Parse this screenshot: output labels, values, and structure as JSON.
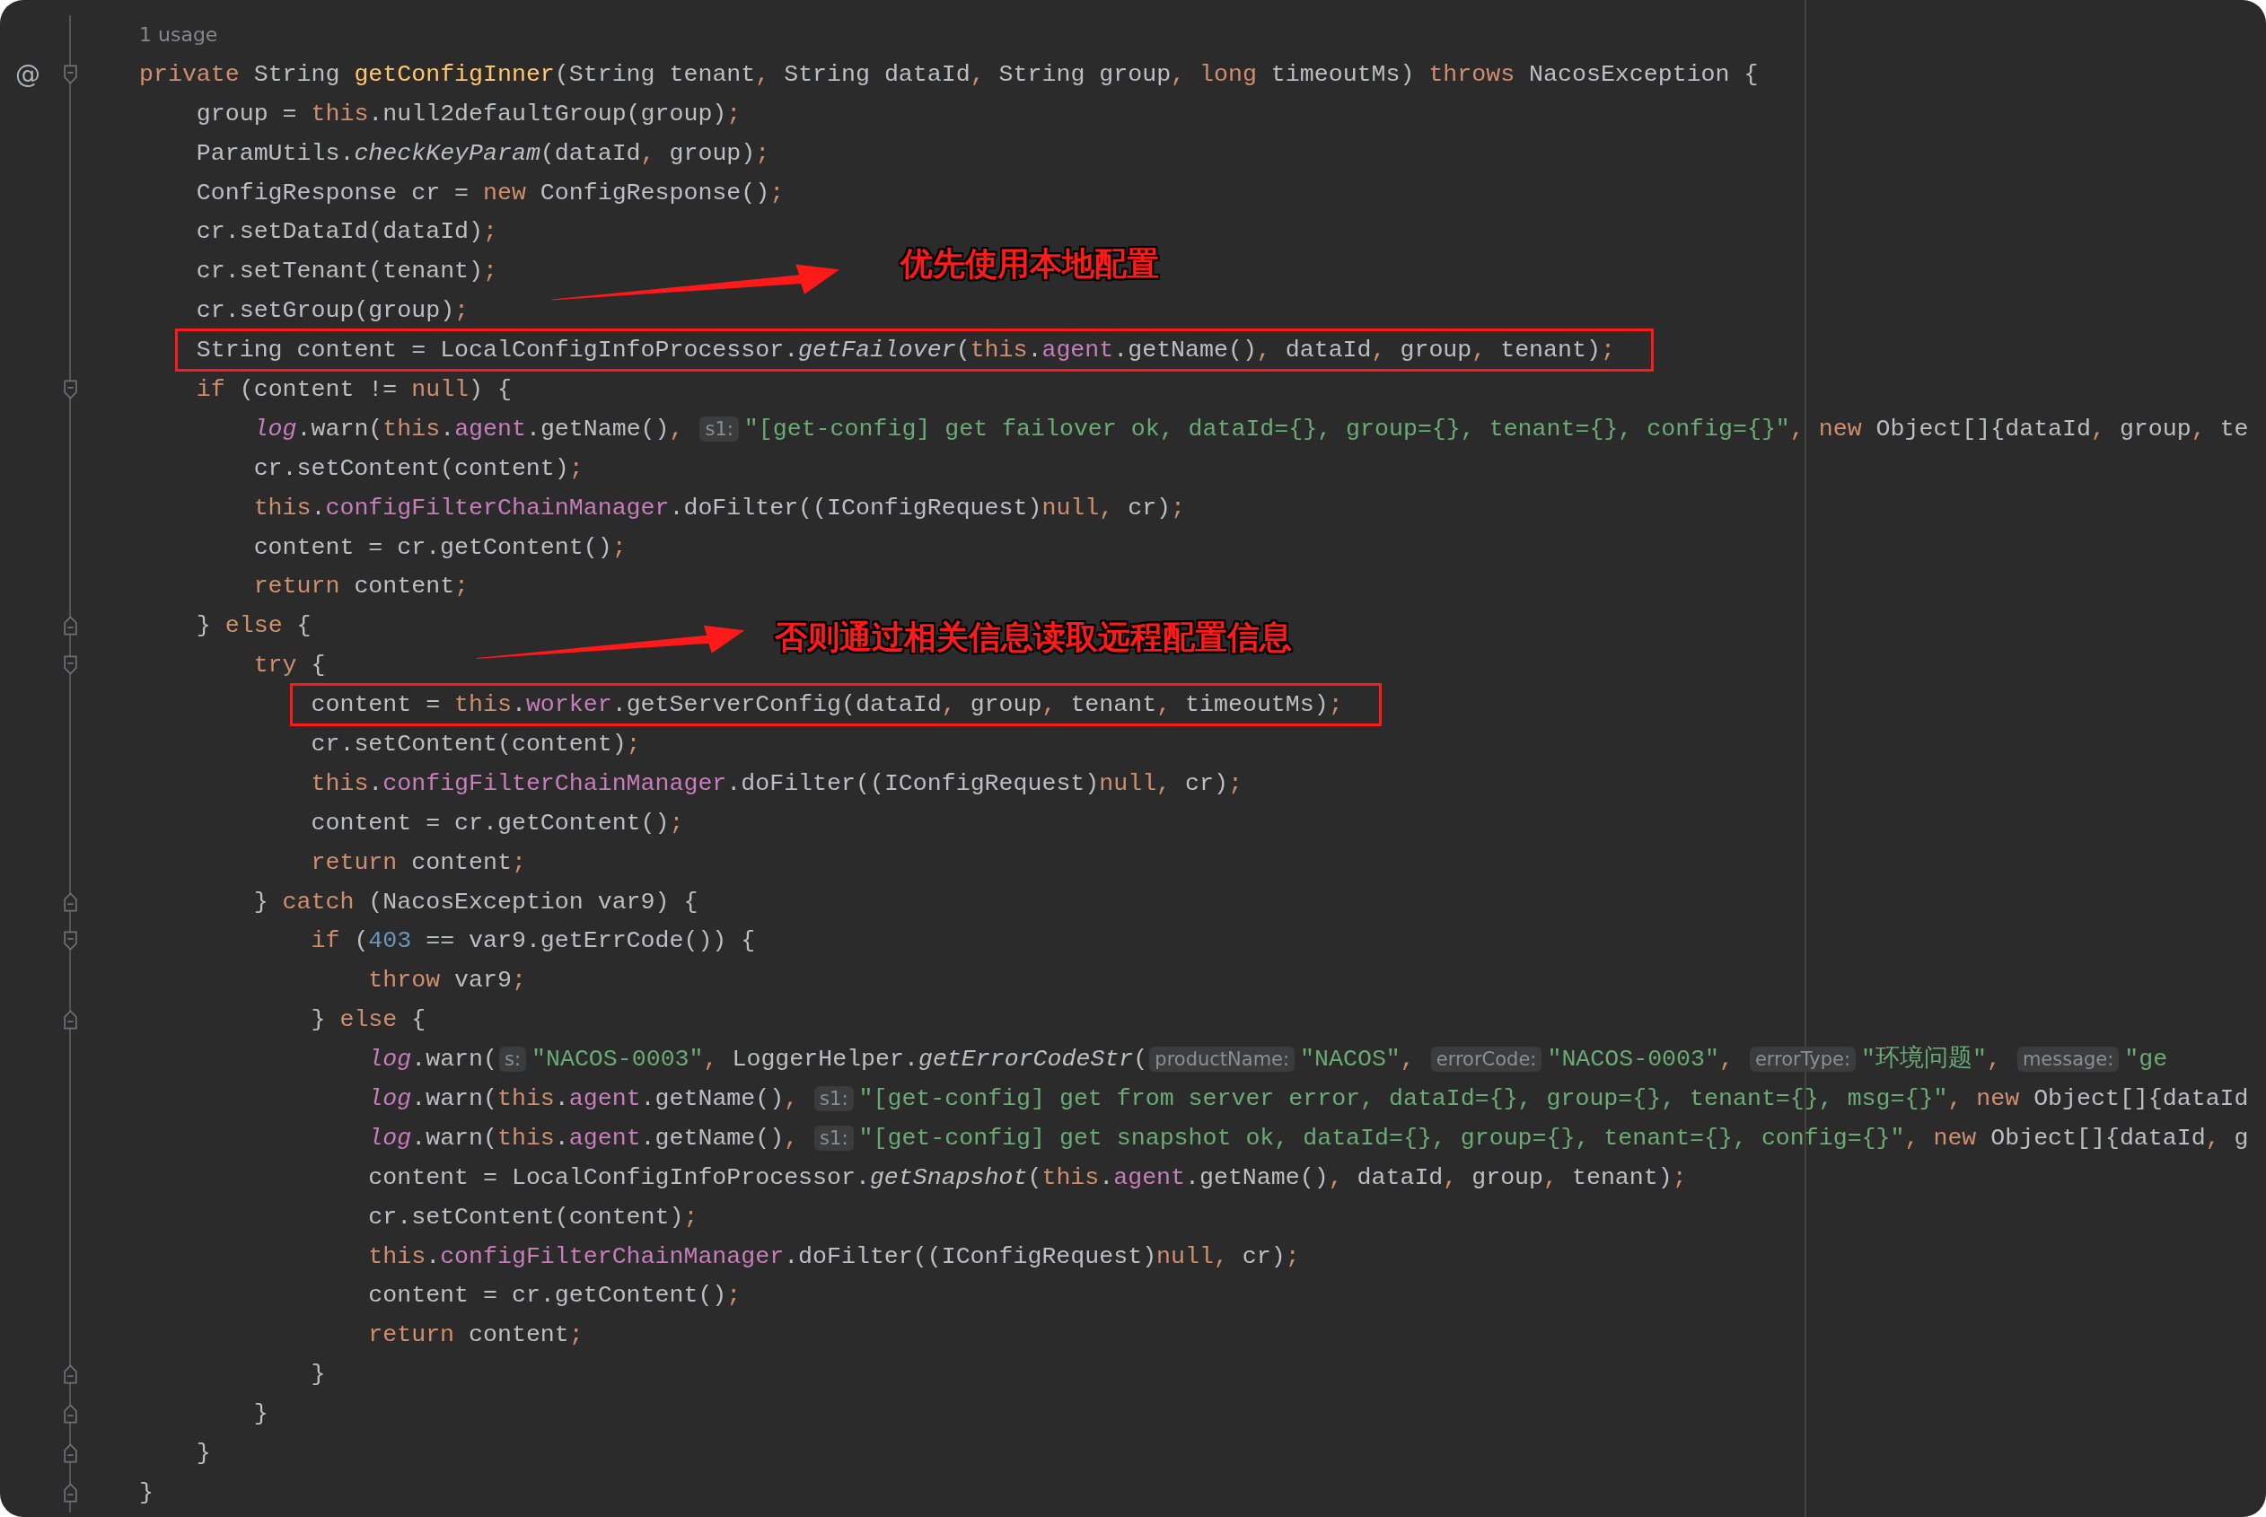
{
  "usages": "1 usage",
  "lines": [
    {
      "gutter_mark": "@",
      "fold_start": true,
      "fold_end": false,
      "highlighted": false,
      "tokens": [
        {
          "kind": "k",
          "text": "private"
        },
        {
          "kind": "p",
          "text": " String "
        },
        {
          "kind": "d",
          "text": "getConfigInner"
        },
        {
          "kind": "p",
          "text": "(String tenant"
        },
        {
          "kind": "k",
          "text": ","
        },
        {
          "kind": "p",
          "text": " String dataId"
        },
        {
          "kind": "k",
          "text": ","
        },
        {
          "kind": "p",
          "text": " String group"
        },
        {
          "kind": "k",
          "text": ", "
        },
        {
          "kind": "k",
          "text": "long"
        },
        {
          "kind": "p",
          "text": " timeoutMs) "
        },
        {
          "kind": "k",
          "text": "throws"
        },
        {
          "kind": "p",
          "text": " NacosException {"
        }
      ],
      "children": [
        {
          "fold_start": false,
          "fold_end": false,
          "highlighted": false,
          "tokens": [
            {
              "kind": "p",
              "text": "group = "
            },
            {
              "kind": "k",
              "text": "this"
            },
            {
              "kind": "p",
              "text": ".null2defaultGroup(group)"
            },
            {
              "kind": "k",
              "text": ";"
            }
          ]
        },
        {
          "fold_start": false,
          "fold_end": false,
          "highlighted": false,
          "tokens": [
            {
              "kind": "p",
              "text": "ParamUtils."
            },
            {
              "kind": "i",
              "text": "checkKeyParam"
            },
            {
              "kind": "p",
              "text": "(dataId"
            },
            {
              "kind": "k",
              "text": ","
            },
            {
              "kind": "p",
              "text": " group)"
            },
            {
              "kind": "k",
              "text": ";"
            }
          ]
        },
        {
          "fold_start": false,
          "fold_end": false,
          "highlighted": false,
          "tokens": [
            {
              "kind": "p",
              "text": "ConfigResponse cr = "
            },
            {
              "kind": "k",
              "text": "new"
            },
            {
              "kind": "p",
              "text": " ConfigResponse()"
            },
            {
              "kind": "k",
              "text": ";"
            }
          ]
        },
        {
          "fold_start": false,
          "fold_end": false,
          "highlighted": false,
          "tokens": [
            {
              "kind": "p",
              "text": "cr.setDataId(dataId)"
            },
            {
              "kind": "k",
              "text": ";"
            }
          ]
        },
        {
          "fold_start": false,
          "fold_end": false,
          "highlighted": false,
          "annotation": {
            "text": "优先使用本地配置"
          },
          "tokens": [
            {
              "kind": "p",
              "text": "cr.setTenant(tenant)"
            },
            {
              "kind": "k",
              "text": ";"
            }
          ]
        },
        {
          "fold_start": false,
          "fold_end": false,
          "highlighted": false,
          "tokens": [
            {
              "kind": "p",
              "text": "cr.setGroup(group)"
            },
            {
              "kind": "k",
              "text": ";"
            }
          ]
        },
        {
          "fold_start": false,
          "fold_end": false,
          "highlighted": true,
          "tokens": [
            {
              "kind": "p",
              "text": "String content = LocalConfigInfoProcessor."
            },
            {
              "kind": "i",
              "text": "getFailover"
            },
            {
              "kind": "p",
              "text": "("
            },
            {
              "kind": "k",
              "text": "this"
            },
            {
              "kind": "p",
              "text": "."
            },
            {
              "kind": "f",
              "text": "agent"
            },
            {
              "kind": "p",
              "text": ".getName()"
            },
            {
              "kind": "k",
              "text": ","
            },
            {
              "kind": "p",
              "text": " dataId"
            },
            {
              "kind": "k",
              "text": ","
            },
            {
              "kind": "p",
              "text": " group"
            },
            {
              "kind": "k",
              "text": ","
            },
            {
              "kind": "p",
              "text": " tenant)"
            },
            {
              "kind": "k",
              "text": ";"
            }
          ]
        },
        {
          "fold_start": true,
          "fold_end": false,
          "highlighted": false,
          "tokens": [
            {
              "kind": "k",
              "text": "if"
            },
            {
              "kind": "p",
              "text": " (content != "
            },
            {
              "kind": "k",
              "text": "null"
            },
            {
              "kind": "p",
              "text": ") {"
            }
          ],
          "children": [
            {
              "fold_start": false,
              "fold_end": false,
              "highlighted": false,
              "tokens": [
                {
                  "kind": "l",
                  "text": "log"
                },
                {
                  "kind": "p",
                  "text": ".warn("
                },
                {
                  "kind": "k",
                  "text": "this"
                },
                {
                  "kind": "p",
                  "text": "."
                },
                {
                  "kind": "f",
                  "text": "agent"
                },
                {
                  "kind": "p",
                  "text": ".getName()"
                },
                {
                  "kind": "k",
                  "text": ", "
                },
                {
                  "kind": "h",
                  "text": "s1:"
                },
                {
                  "kind": "s",
                  "text": "\"[get-config] get failover ok, dataId={}, group={}, tenant={}, config={}\""
                },
                {
                  "kind": "k",
                  "text": ", "
                },
                {
                  "kind": "k",
                  "text": "new"
                },
                {
                  "kind": "p",
                  "text": " Object[]{dataId"
                },
                {
                  "kind": "k",
                  "text": ","
                },
                {
                  "kind": "p",
                  "text": " group"
                },
                {
                  "kind": "k",
                  "text": ","
                },
                {
                  "kind": "p",
                  "text": " te"
                }
              ]
            },
            {
              "fold_start": false,
              "fold_end": false,
              "highlighted": false,
              "tokens": [
                {
                  "kind": "p",
                  "text": "cr.setContent(content)"
                },
                {
                  "kind": "k",
                  "text": ";"
                }
              ]
            },
            {
              "fold_start": false,
              "fold_end": false,
              "highlighted": false,
              "tokens": [
                {
                  "kind": "k",
                  "text": "this"
                },
                {
                  "kind": "p",
                  "text": "."
                },
                {
                  "kind": "f",
                  "text": "configFilterChainManager"
                },
                {
                  "kind": "p",
                  "text": ".doFilter((IConfigRequest)"
                },
                {
                  "kind": "k",
                  "text": "null"
                },
                {
                  "kind": "k",
                  "text": ","
                },
                {
                  "kind": "p",
                  "text": " cr)"
                },
                {
                  "kind": "k",
                  "text": ";"
                }
              ]
            },
            {
              "fold_start": false,
              "fold_end": false,
              "highlighted": false,
              "tokens": [
                {
                  "kind": "p",
                  "text": "content = cr.getContent()"
                },
                {
                  "kind": "k",
                  "text": ";"
                }
              ]
            },
            {
              "fold_start": false,
              "fold_end": false,
              "highlighted": false,
              "tokens": [
                {
                  "kind": "k",
                  "text": "return"
                },
                {
                  "kind": "p",
                  "text": " content"
                },
                {
                  "kind": "k",
                  "text": ";"
                }
              ]
            }
          ]
        },
        {
          "fold_start": false,
          "fold_end": true,
          "highlighted": false,
          "annotation": {
            "text": "否则通过相关信息读取远程配置信息"
          },
          "tokens": [
            {
              "kind": "p",
              "text": "} "
            },
            {
              "kind": "k",
              "text": "else"
            },
            {
              "kind": "p",
              "text": " {"
            }
          ],
          "children": [
            {
              "fold_start": true,
              "fold_end": false,
              "highlighted": false,
              "tokens": [
                {
                  "kind": "k",
                  "text": "try"
                },
                {
                  "kind": "p",
                  "text": " {"
                }
              ],
              "children": [
                {
                  "fold_start": false,
                  "fold_end": false,
                  "highlighted": true,
                  "tokens": [
                    {
                      "kind": "p",
                      "text": "content = "
                    },
                    {
                      "kind": "k",
                      "text": "this"
                    },
                    {
                      "kind": "p",
                      "text": "."
                    },
                    {
                      "kind": "f",
                      "text": "worker"
                    },
                    {
                      "kind": "p",
                      "text": ".getServerConfig(dataId"
                    },
                    {
                      "kind": "k",
                      "text": ","
                    },
                    {
                      "kind": "p",
                      "text": " group"
                    },
                    {
                      "kind": "k",
                      "text": ","
                    },
                    {
                      "kind": "p",
                      "text": " tenant"
                    },
                    {
                      "kind": "k",
                      "text": ","
                    },
                    {
                      "kind": "p",
                      "text": " timeoutMs)"
                    },
                    {
                      "kind": "k",
                      "text": ";"
                    }
                  ]
                },
                {
                  "fold_start": false,
                  "fold_end": false,
                  "highlighted": false,
                  "tokens": [
                    {
                      "kind": "p",
                      "text": "cr.setContent(content)"
                    },
                    {
                      "kind": "k",
                      "text": ";"
                    }
                  ]
                },
                {
                  "fold_start": false,
                  "fold_end": false,
                  "highlighted": false,
                  "tokens": [
                    {
                      "kind": "k",
                      "text": "this"
                    },
                    {
                      "kind": "p",
                      "text": "."
                    },
                    {
                      "kind": "f",
                      "text": "configFilterChainManager"
                    },
                    {
                      "kind": "p",
                      "text": ".doFilter((IConfigRequest)"
                    },
                    {
                      "kind": "k",
                      "text": "null"
                    },
                    {
                      "kind": "k",
                      "text": ","
                    },
                    {
                      "kind": "p",
                      "text": " cr)"
                    },
                    {
                      "kind": "k",
                      "text": ";"
                    }
                  ]
                },
                {
                  "fold_start": false,
                  "fold_end": false,
                  "highlighted": false,
                  "tokens": [
                    {
                      "kind": "p",
                      "text": "content = cr.getContent()"
                    },
                    {
                      "kind": "k",
                      "text": ";"
                    }
                  ]
                },
                {
                  "fold_start": false,
                  "fold_end": false,
                  "highlighted": false,
                  "tokens": [
                    {
                      "kind": "k",
                      "text": "return"
                    },
                    {
                      "kind": "p",
                      "text": " content"
                    },
                    {
                      "kind": "k",
                      "text": ";"
                    }
                  ]
                }
              ]
            },
            {
              "fold_start": false,
              "fold_end": true,
              "highlighted": false,
              "tokens": [
                {
                  "kind": "p",
                  "text": "} "
                },
                {
                  "kind": "k",
                  "text": "catch"
                },
                {
                  "kind": "p",
                  "text": " (NacosException var9) {"
                }
              ],
              "children": [
                {
                  "fold_start": true,
                  "fold_end": false,
                  "highlighted": false,
                  "tokens": [
                    {
                      "kind": "k",
                      "text": "if"
                    },
                    {
                      "kind": "p",
                      "text": " ("
                    },
                    {
                      "kind": "n",
                      "text": "403"
                    },
                    {
                      "kind": "p",
                      "text": " == var9.getErrCode()) {"
                    }
                  ],
                  "children": [
                    {
                      "fold_start": false,
                      "fold_end": false,
                      "highlighted": false,
                      "tokens": [
                        {
                          "kind": "k",
                          "text": "throw"
                        },
                        {
                          "kind": "p",
                          "text": " var9"
                        },
                        {
                          "kind": "k",
                          "text": ";"
                        }
                      ]
                    }
                  ]
                },
                {
                  "fold_start": false,
                  "fold_end": true,
                  "highlighted": false,
                  "tokens": [
                    {
                      "kind": "p",
                      "text": "} "
                    },
                    {
                      "kind": "k",
                      "text": "else"
                    },
                    {
                      "kind": "p",
                      "text": " {"
                    }
                  ],
                  "children": [
                    {
                      "fold_start": false,
                      "fold_end": false,
                      "highlighted": false,
                      "tokens": [
                        {
                          "kind": "l",
                          "text": "log"
                        },
                        {
                          "kind": "p",
                          "text": ".warn("
                        },
                        {
                          "kind": "h",
                          "text": "s:"
                        },
                        {
                          "kind": "s",
                          "text": "\"NACOS-0003\""
                        },
                        {
                          "kind": "k",
                          "text": ","
                        },
                        {
                          "kind": "p",
                          "text": " LoggerHelper."
                        },
                        {
                          "kind": "i",
                          "text": "getErrorCodeStr"
                        },
                        {
                          "kind": "p",
                          "text": "("
                        },
                        {
                          "kind": "h",
                          "text": "productName:"
                        },
                        {
                          "kind": "s",
                          "text": "\"NACOS\""
                        },
                        {
                          "kind": "k",
                          "text": ", "
                        },
                        {
                          "kind": "h",
                          "text": "errorCode:"
                        },
                        {
                          "kind": "s",
                          "text": "\"NACOS-0003\""
                        },
                        {
                          "kind": "k",
                          "text": ", "
                        },
                        {
                          "kind": "h",
                          "text": "errorType:"
                        },
                        {
                          "kind": "s",
                          "text": "\"环境问题\""
                        },
                        {
                          "kind": "k",
                          "text": ", "
                        },
                        {
                          "kind": "h",
                          "text": "message:"
                        },
                        {
                          "kind": "s",
                          "text": "\"ge"
                        }
                      ]
                    },
                    {
                      "fold_start": false,
                      "fold_end": false,
                      "highlighted": false,
                      "tokens": [
                        {
                          "kind": "l",
                          "text": "log"
                        },
                        {
                          "kind": "p",
                          "text": ".warn("
                        },
                        {
                          "kind": "k",
                          "text": "this"
                        },
                        {
                          "kind": "p",
                          "text": "."
                        },
                        {
                          "kind": "f",
                          "text": "agent"
                        },
                        {
                          "kind": "p",
                          "text": ".getName()"
                        },
                        {
                          "kind": "k",
                          "text": ", "
                        },
                        {
                          "kind": "h",
                          "text": "s1:"
                        },
                        {
                          "kind": "s",
                          "text": "\"[get-config] get from server error, dataId={}, group={}, tenant={}, msg={}\""
                        },
                        {
                          "kind": "k",
                          "text": ", "
                        },
                        {
                          "kind": "k",
                          "text": "new"
                        },
                        {
                          "kind": "p",
                          "text": " Object[]{dataId"
                        }
                      ]
                    },
                    {
                      "fold_start": false,
                      "fold_end": false,
                      "highlighted": false,
                      "tokens": [
                        {
                          "kind": "l",
                          "text": "log"
                        },
                        {
                          "kind": "p",
                          "text": ".warn("
                        },
                        {
                          "kind": "k",
                          "text": "this"
                        },
                        {
                          "kind": "p",
                          "text": "."
                        },
                        {
                          "kind": "f",
                          "text": "agent"
                        },
                        {
                          "kind": "p",
                          "text": ".getName()"
                        },
                        {
                          "kind": "k",
                          "text": ", "
                        },
                        {
                          "kind": "h",
                          "text": "s1:"
                        },
                        {
                          "kind": "s",
                          "text": "\"[get-config] get snapshot ok, dataId={}, group={}, tenant={}, config={}\""
                        },
                        {
                          "kind": "k",
                          "text": ", "
                        },
                        {
                          "kind": "k",
                          "text": "new"
                        },
                        {
                          "kind": "p",
                          "text": " Object[]{dataId"
                        },
                        {
                          "kind": "k",
                          "text": ","
                        },
                        {
                          "kind": "p",
                          "text": " g"
                        }
                      ]
                    },
                    {
                      "fold_start": false,
                      "fold_end": false,
                      "highlighted": false,
                      "tokens": [
                        {
                          "kind": "p",
                          "text": "content = LocalConfigInfoProcessor."
                        },
                        {
                          "kind": "i",
                          "text": "getSnapshot"
                        },
                        {
                          "kind": "p",
                          "text": "("
                        },
                        {
                          "kind": "k",
                          "text": "this"
                        },
                        {
                          "kind": "p",
                          "text": "."
                        },
                        {
                          "kind": "f",
                          "text": "agent"
                        },
                        {
                          "kind": "p",
                          "text": ".getName()"
                        },
                        {
                          "kind": "k",
                          "text": ","
                        },
                        {
                          "kind": "p",
                          "text": " dataId"
                        },
                        {
                          "kind": "k",
                          "text": ","
                        },
                        {
                          "kind": "p",
                          "text": " group"
                        },
                        {
                          "kind": "k",
                          "text": ","
                        },
                        {
                          "kind": "p",
                          "text": " tenant)"
                        },
                        {
                          "kind": "k",
                          "text": ";"
                        }
                      ]
                    },
                    {
                      "fold_start": false,
                      "fold_end": false,
                      "highlighted": false,
                      "tokens": [
                        {
                          "kind": "p",
                          "text": "cr.setContent(content)"
                        },
                        {
                          "kind": "k",
                          "text": ";"
                        }
                      ]
                    },
                    {
                      "fold_start": false,
                      "fold_end": false,
                      "highlighted": false,
                      "tokens": [
                        {
                          "kind": "k",
                          "text": "this"
                        },
                        {
                          "kind": "p",
                          "text": "."
                        },
                        {
                          "kind": "f",
                          "text": "configFilterChainManager"
                        },
                        {
                          "kind": "p",
                          "text": ".doFilter((IConfigRequest)"
                        },
                        {
                          "kind": "k",
                          "text": "null"
                        },
                        {
                          "kind": "k",
                          "text": ","
                        },
                        {
                          "kind": "p",
                          "text": " cr)"
                        },
                        {
                          "kind": "k",
                          "text": ";"
                        }
                      ]
                    },
                    {
                      "fold_start": false,
                      "fold_end": false,
                      "highlighted": false,
                      "tokens": [
                        {
                          "kind": "p",
                          "text": "content = cr.getContent()"
                        },
                        {
                          "kind": "k",
                          "text": ";"
                        }
                      ]
                    },
                    {
                      "fold_start": false,
                      "fold_end": false,
                      "highlighted": false,
                      "tokens": [
                        {
                          "kind": "k",
                          "text": "return"
                        },
                        {
                          "kind": "p",
                          "text": " content"
                        },
                        {
                          "kind": "k",
                          "text": ";"
                        }
                      ]
                    }
                  ]
                },
                {
                  "fold_start": false,
                  "fold_end": true,
                  "highlighted": false,
                  "tokens": [
                    {
                      "kind": "p",
                      "text": "}"
                    }
                  ]
                }
              ]
            },
            {
              "fold_start": false,
              "fold_end": true,
              "highlighted": false,
              "tokens": [
                {
                  "kind": "p",
                  "text": "}"
                }
              ]
            }
          ]
        },
        {
          "fold_start": false,
          "fold_end": true,
          "highlighted": false,
          "tokens": [
            {
              "kind": "p",
              "text": "}"
            }
          ]
        }
      ]
    },
    {
      "fold_start": false,
      "fold_end": true,
      "highlighted": false,
      "tokens": [
        {
          "kind": "p",
          "text": "}"
        }
      ]
    }
  ]
}
